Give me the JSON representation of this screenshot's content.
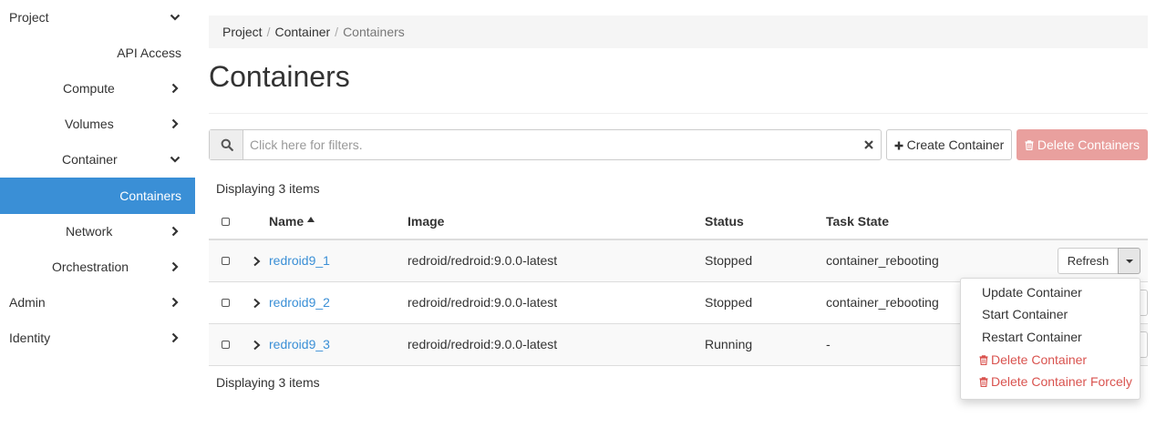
{
  "sidebar": {
    "project": "Project",
    "api_access": "API Access",
    "compute": "Compute",
    "volumes": "Volumes",
    "container": "Container",
    "containers": "Containers",
    "network": "Network",
    "orchestration": "Orchestration",
    "admin": "Admin",
    "identity": "Identity"
  },
  "breadcrumb": [
    "Project",
    "Container",
    "Containers"
  ],
  "page_title": "Containers",
  "filter": {
    "placeholder": "Click here for filters."
  },
  "toolbar": {
    "create_label": "Create Container",
    "delete_label": "Delete Containers"
  },
  "display_count": "Displaying 3 items",
  "table": {
    "columns": [
      "Name",
      "Image",
      "Status",
      "Task State"
    ],
    "rows": [
      {
        "name": "redroid9_1",
        "image": "redroid/redroid:9.0.0-latest",
        "status": "Stopped",
        "task_state": "container_rebooting"
      },
      {
        "name": "redroid9_2",
        "image": "redroid/redroid:9.0.0-latest",
        "status": "Stopped",
        "task_state": "container_rebooting"
      },
      {
        "name": "redroid9_3",
        "image": "redroid/redroid:9.0.0-latest",
        "status": "Running",
        "task_state": "-"
      }
    ]
  },
  "row_action": {
    "label": "Refresh"
  },
  "dropdown": {
    "items": [
      "Update Container",
      "Start Container",
      "Restart Container",
      "Delete Container",
      "Delete Container Forcely"
    ]
  },
  "colors": {
    "accent": "#3a8fd6",
    "danger": "#d9534f",
    "danger_light": "#e9a09e"
  },
  "icons": [
    "chevron-down-icon",
    "chevron-right-icon",
    "search-icon",
    "close-icon",
    "plus-icon",
    "trash-icon",
    "sort-asc-icon",
    "caret-down-icon"
  ]
}
